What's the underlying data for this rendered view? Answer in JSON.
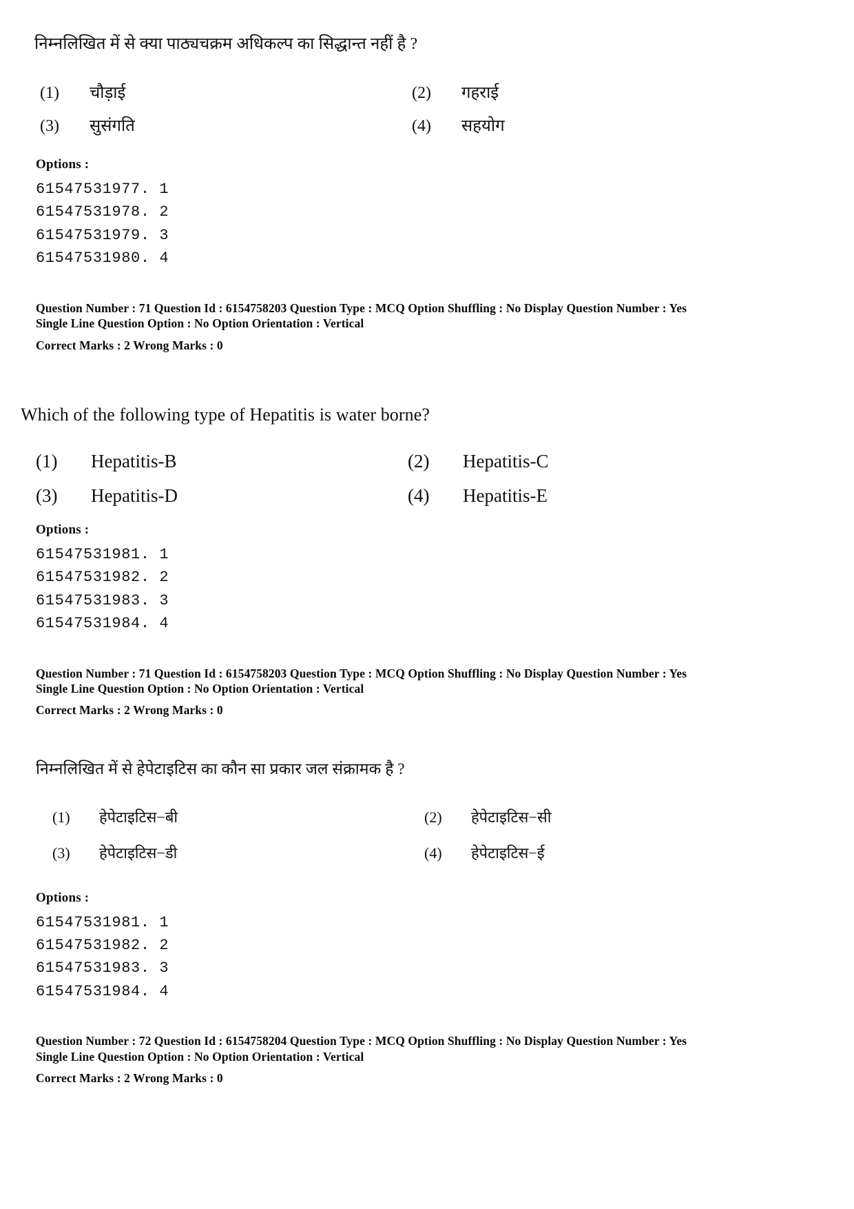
{
  "page": {
    "language_note": "Bilingual MCQ exam answer-key document page"
  },
  "labels": {
    "options_label": "Options :"
  },
  "questions": [
    {
      "id": "q71-hindi",
      "language": "hindi",
      "text": "निम्नलिखित में से क्या पाठ्यचक्रम अधिकल्प का सिद्धान्त नहीं है ?",
      "options": [
        {
          "num": "(1)",
          "text": "चौड़ाई"
        },
        {
          "num": "(2)",
          "text": "गहराई"
        },
        {
          "num": "(3)",
          "text": "सुसंगति"
        },
        {
          "num": "(4)",
          "text": "सहयोग"
        }
      ],
      "option_ids": [
        "61547531977. 1",
        "61547531978. 2",
        "61547531979. 3",
        "61547531980. 4"
      ],
      "meta": {
        "line1": "Question Number : 71  Question Id : 6154758203  Question Type : MCQ  Option Shuffling : No  Display Question Number : Yes",
        "line2": "Single Line Question Option : No  Option Orientation : Vertical",
        "line3": "Correct Marks : 2  Wrong Marks : 0"
      }
    },
    {
      "id": "q71-english",
      "language": "english",
      "text": "Which of the following type of Hepatitis is water borne?",
      "options": [
        {
          "num": "(1)",
          "text": "Hepatitis-B"
        },
        {
          "num": "(2)",
          "text": "Hepatitis-C"
        },
        {
          "num": "(3)",
          "text": "Hepatitis-D"
        },
        {
          "num": "(4)",
          "text": "Hepatitis-E"
        }
      ],
      "option_ids": [
        "61547531981. 1",
        "61547531982. 2",
        "61547531983. 3",
        "61547531984. 4"
      ],
      "meta": {
        "line1": "Question Number : 71  Question Id : 6154758203  Question Type : MCQ  Option Shuffling : No  Display Question Number : Yes",
        "line2": "Single Line Question Option : No  Option Orientation : Vertical",
        "line3": "Correct Marks : 2  Wrong Marks : 0"
      }
    },
    {
      "id": "q72-hindi",
      "language": "hindi",
      "text": "निम्नलिखित में से हेपेटाइटिस का कौन सा प्रकार जल संक्रामक है ?",
      "options": [
        {
          "num": "(1)",
          "text": "हेपेटाइटिस−बी"
        },
        {
          "num": "(2)",
          "text": "हेपेटाइटिस−सी"
        },
        {
          "num": "(3)",
          "text": "हेपेटाइटिस−डी"
        },
        {
          "num": "(4)",
          "text": "हेपेटाइटिस−ई"
        }
      ],
      "option_ids": [
        "61547531981. 1",
        "61547531982. 2",
        "61547531983. 3",
        "61547531984. 4"
      ],
      "meta": {
        "line1": "Question Number : 72  Question Id : 6154758204  Question Type : MCQ  Option Shuffling : No  Display Question Number : Yes",
        "line2": "Single Line Question Option : No  Option Orientation : Vertical",
        "line3": "Correct Marks : 2  Wrong Marks : 0"
      }
    }
  ]
}
